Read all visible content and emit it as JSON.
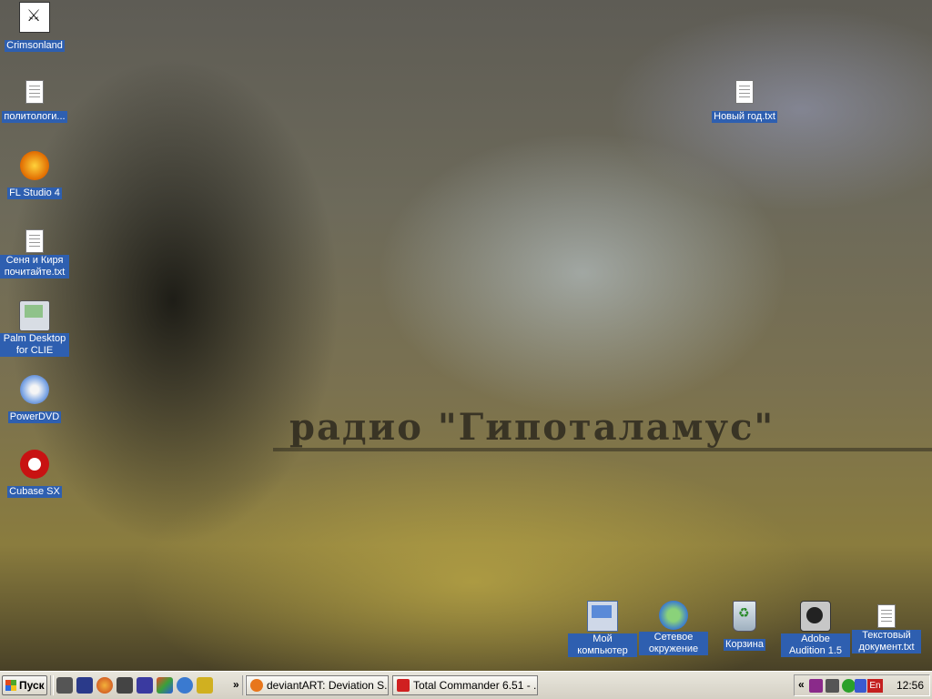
{
  "wallpaper": {
    "text": "радио \"Гипоталамус\""
  },
  "desktop": {
    "icons_left": [
      {
        "label": "Crimsonland",
        "icon": "crimsonland-icon"
      },
      {
        "label": "политологи...",
        "icon": "text-document-icon"
      },
      {
        "label": "FL Studio 4",
        "icon": "fl-studio-icon"
      },
      {
        "label": "Сеня и Киря почитайте.txt",
        "icon": "text-document-icon"
      },
      {
        "label": "Palm Desktop for CLIE",
        "icon": "palm-desktop-icon"
      },
      {
        "label": "PowerDVD",
        "icon": "powerdvd-icon"
      },
      {
        "label": "Cubase SX",
        "icon": "cubase-icon"
      }
    ],
    "icon_new_year": {
      "label": "Новый год.txt",
      "icon": "text-document-icon"
    },
    "icons_bottom": [
      {
        "label": "Мой компьютер",
        "icon": "my-computer-icon"
      },
      {
        "label": "Сетевое окружение",
        "icon": "network-places-icon"
      },
      {
        "label": "Корзина",
        "icon": "recycle-bin-icon"
      },
      {
        "label": "Adobe Audition 1.5",
        "icon": "adobe-audition-icon"
      },
      {
        "label": "Текстовый документ.txt",
        "icon": "text-document-icon"
      }
    ]
  },
  "taskbar": {
    "start_label": "Пуск",
    "quick_launch": [
      "show-desktop-icon",
      "winamp-icon",
      "firefox-icon",
      "save-icon",
      "game-icon",
      "map-icon",
      "bs-icon",
      "glasses-icon"
    ],
    "overflow": "»",
    "tasks": [
      {
        "label": "deviantART: Deviation S...",
        "icon": "firefox-icon",
        "color": "#e8761c"
      },
      {
        "label": "Total Commander 6.51 - ...",
        "icon": "total-commander-icon",
        "color": "#d02020"
      }
    ],
    "tray": {
      "collapse": "«",
      "lang": "En",
      "clock": "12:56"
    }
  }
}
